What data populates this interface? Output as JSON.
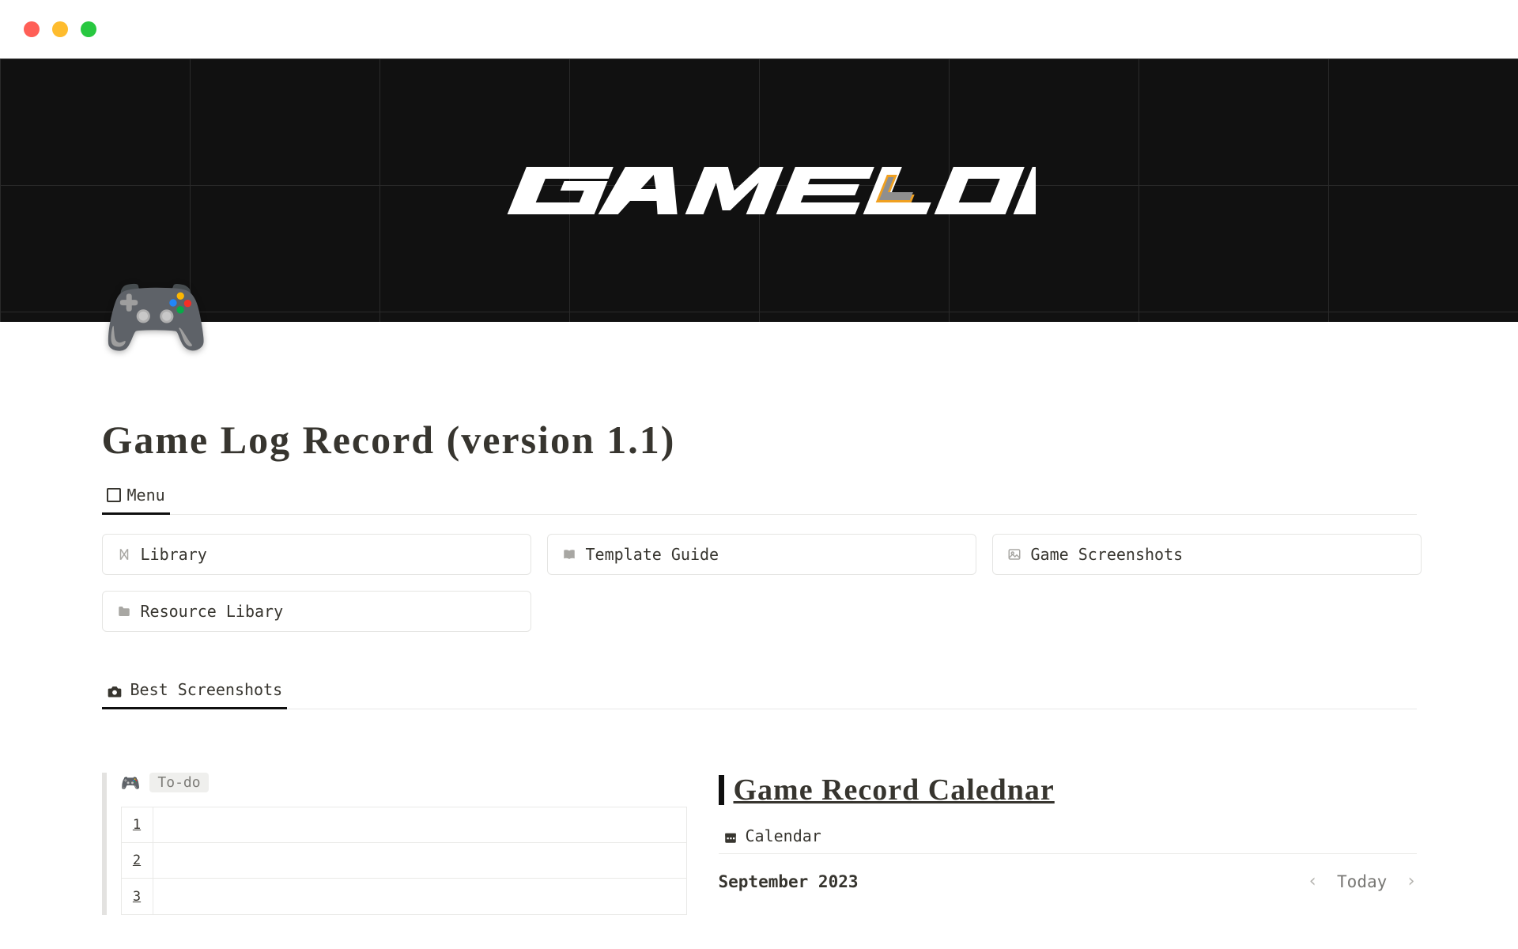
{
  "cover": {
    "logo_text": "GAMELOG"
  },
  "page_icon": "🎮",
  "page_title": "Game Log Record (version 1.1)",
  "menu_tab": {
    "label": "Menu"
  },
  "cards": {
    "library": "Library",
    "template_guide": "Template Guide",
    "game_screenshots": "Game Screenshots",
    "resource_library": "Resource Libary"
  },
  "best_screenshots_tab": "Best Screenshots",
  "todo": {
    "icon": "🎮",
    "tag": "To-do",
    "rows": [
      "1",
      "2",
      "3"
    ]
  },
  "calendar": {
    "title": "Game Record Calednar",
    "tab_label": "Calendar",
    "month_label": "September 2023",
    "today_label": "Today"
  }
}
